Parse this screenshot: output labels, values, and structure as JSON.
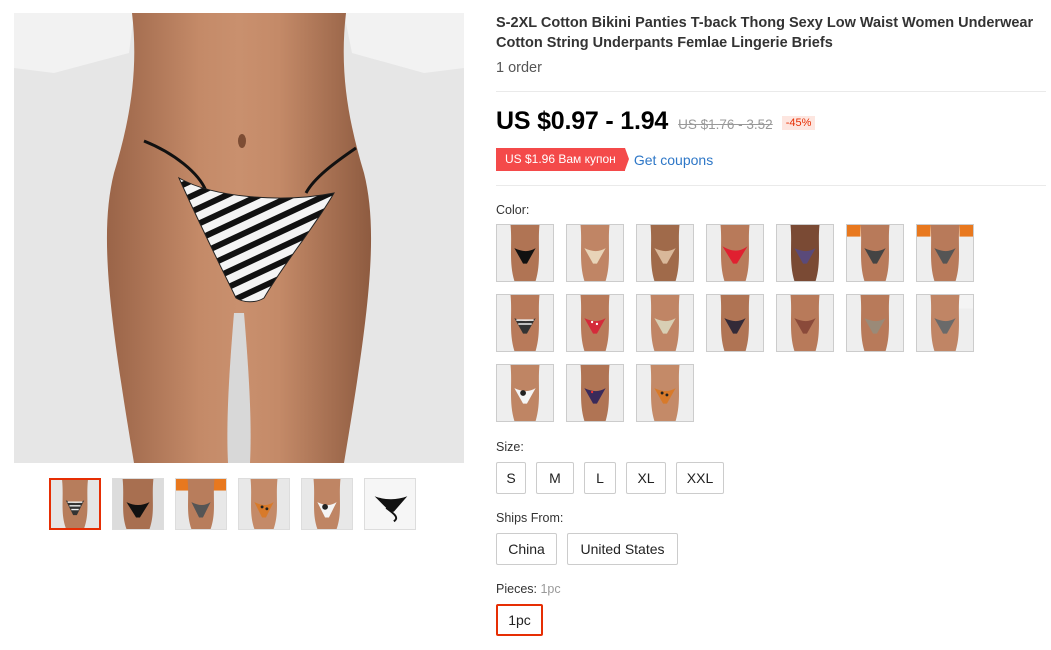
{
  "product": {
    "title": "S-2XL Cotton Bikini Panties T-back Thong Sexy Low Waist Women Underwear Cotton String Underpants Femlae Lingerie Briefs",
    "orders": "1 order"
  },
  "price": {
    "current": "US $0.97 - 1.94",
    "original": "US $1.76 - 3.52",
    "discount": "-45%"
  },
  "coupon": {
    "badge": "US $1.96 Вам купон",
    "link": "Get coupons"
  },
  "gallery": {
    "thumbs": [
      "zebra",
      "black",
      "orange-print",
      "leopard",
      "cow",
      "flat-black"
    ],
    "active_index": 0
  },
  "color": {
    "label": "Color:",
    "swatches": [
      "black",
      "beige",
      "nude",
      "red",
      "purple",
      "checker",
      "checker-orange",
      "zebra",
      "red-dot",
      "camo",
      "dark",
      "leopard-red",
      "snake",
      "grey",
      "cow",
      "purple-dot",
      "leopard"
    ]
  },
  "size": {
    "label": "Size:",
    "options": [
      "S",
      "M",
      "L",
      "XL",
      "XXL"
    ]
  },
  "ships_from": {
    "label": "Ships From:",
    "options": [
      "China",
      "United States"
    ]
  },
  "pieces": {
    "label": "Pieces:",
    "selected_value": "1pc",
    "options": [
      "1pc"
    ]
  },
  "colors": {
    "accent": "#e62e04",
    "coupon_bg": "#f44a4a",
    "link": "#2e77c7"
  }
}
